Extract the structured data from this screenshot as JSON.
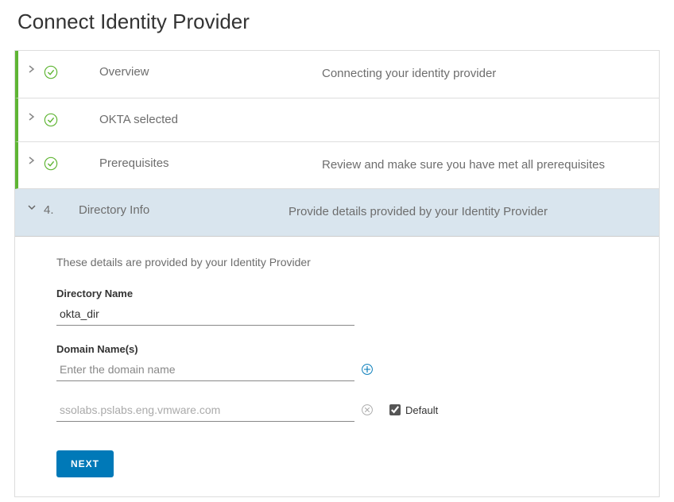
{
  "title": "Connect Identity Provider",
  "steps": [
    {
      "label": "Overview",
      "desc": "Connecting your identity provider"
    },
    {
      "label": "OKTA selected",
      "desc": ""
    },
    {
      "label": "Prerequisites",
      "desc": "Review and make sure you have met all prerequisites"
    }
  ],
  "activeStep": {
    "number": "4.",
    "label": "Directory Info",
    "desc": "Provide details provided by your Identity Provider"
  },
  "form": {
    "intro": "These details are provided by your Identity Provider",
    "directoryNameLabel": "Directory Name",
    "directoryNameValue": "okta_dir",
    "domainNamesLabel": "Domain Name(s)",
    "domainNamePlaceholder": "Enter the domain name",
    "domainExisting": "ssolabs.pslabs.eng.vmware.com",
    "defaultLabel": "Default",
    "nextLabel": "NEXT"
  }
}
